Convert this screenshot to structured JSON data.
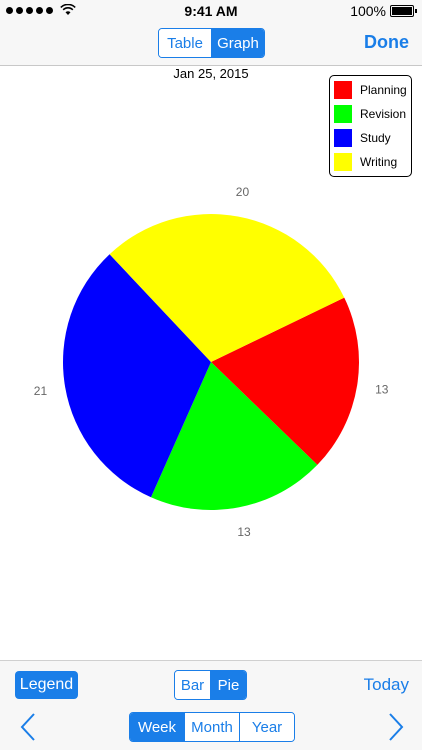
{
  "status_bar": {
    "time": "9:41 AM",
    "battery": "100%"
  },
  "nav": {
    "segments": [
      {
        "label": "Table",
        "selected": false
      },
      {
        "label": "Graph",
        "selected": true
      }
    ],
    "done_label": "Done"
  },
  "date_label": "Jan 25, 2015",
  "legend": [
    {
      "label": "Planning",
      "color": "#ff0000"
    },
    {
      "label": "Revision",
      "color": "#00ff00"
    },
    {
      "label": "Study",
      "color": "#0000ff"
    },
    {
      "label": "Writing",
      "color": "#ffff00"
    }
  ],
  "chart_data": {
    "type": "pie",
    "categories": [
      "Planning",
      "Revision",
      "Study",
      "Writing"
    ],
    "values": [
      13,
      13,
      21,
      20
    ],
    "colors": [
      "#ff0000",
      "#00ff00",
      "#0000ff",
      "#ffff00"
    ],
    "legend_position": "top-right"
  },
  "toolbar": {
    "legend_button": "Legend",
    "chart_types": [
      {
        "label": "Bar",
        "selected": false
      },
      {
        "label": "Pie",
        "selected": true
      }
    ],
    "today_label": "Today",
    "periods": [
      {
        "label": "Week",
        "selected": true
      },
      {
        "label": "Month",
        "selected": false
      },
      {
        "label": "Year",
        "selected": false
      }
    ]
  }
}
